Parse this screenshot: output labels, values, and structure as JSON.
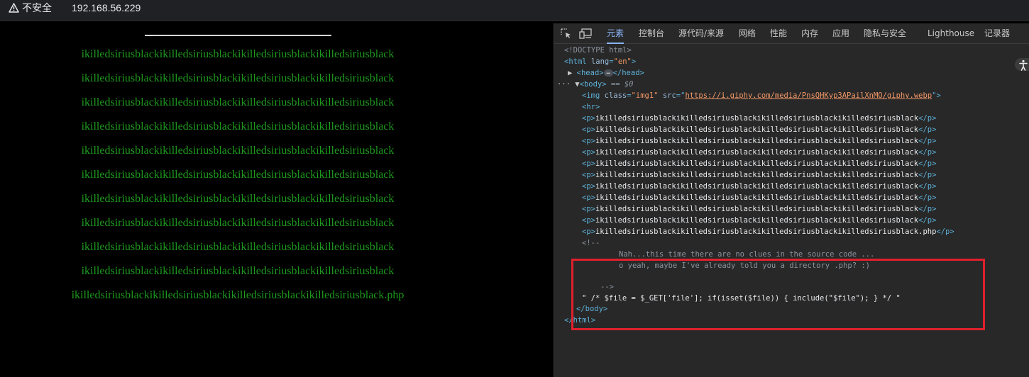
{
  "addressbar": {
    "security_text": "不安全",
    "url": "192.168.56.229"
  },
  "page": {
    "paragraphs": [
      "ikilledsiriusblackikilledsiriusblackikilledsiriusblackikilledsiriusblack",
      "ikilledsiriusblackikilledsiriusblackikilledsiriusblackikilledsiriusblack",
      "ikilledsiriusblackikilledsiriusblackikilledsiriusblackikilledsiriusblack",
      "ikilledsiriusblackikilledsiriusblackikilledsiriusblackikilledsiriusblack",
      "ikilledsiriusblackikilledsiriusblackikilledsiriusblackikilledsiriusblack",
      "ikilledsiriusblackikilledsiriusblackikilledsiriusblackikilledsiriusblack",
      "ikilledsiriusblackikilledsiriusblackikilledsiriusblackikilledsiriusblack",
      "ikilledsiriusblackikilledsiriusblackikilledsiriusblackikilledsiriusblack",
      "ikilledsiriusblackikilledsiriusblackikilledsiriusblackikilledsiriusblack",
      "ikilledsiriusblackikilledsiriusblackikilledsiriusblackikilledsiriusblack",
      "ikilledsiriusblackikilledsiriusblackikilledsiriusblackikilledsiriusblack.php"
    ],
    "text_color": "#1e9a1e"
  },
  "devtools": {
    "tabs": [
      "元素",
      "控制台",
      "源代码/来源",
      "网络",
      "性能",
      "内存",
      "应用",
      "隐私与安全",
      "Lighthouse",
      "记录器"
    ],
    "active_tab": "元素",
    "doctype": "<!DOCTYPE html>",
    "html_open": "<html",
    "lang_attr": "lang",
    "lang_val": "\"en\"",
    "head_open": "<head>",
    "head_close": "</head>",
    "body_open": "<body>",
    "body_eq": " == $0",
    "img_open": "<img",
    "img_class_attr": "class",
    "img_class_val": "\"img1\"",
    "img_src_attr": "src",
    "img_src_url": "https://i.giphy.com/media/PnsQHKyp3APailXnMO/giphy.webp",
    "img_close": "\">",
    "hr": "<hr>",
    "p_open": "<p>",
    "p_close": "</p>",
    "p_texts": [
      "ikilledsiriusblackikilledsiriusblackikilledsiriusblackikilledsiriusblack",
      "ikilledsiriusblackikilledsiriusblackikilledsiriusblackikilledsiriusblack",
      "ikilledsiriusblackikilledsiriusblackikilledsiriusblackikilledsiriusblack",
      "ikilledsiriusblackikilledsiriusblackikilledsiriusblackikilledsiriusblack",
      "ikilledsiriusblackikilledsiriusblackikilledsiriusblackikilledsiriusblack",
      "ikilledsiriusblackikilledsiriusblackikilledsiriusblackikilledsiriusblack",
      "ikilledsiriusblackikilledsiriusblackikilledsiriusblackikilledsiriusblack",
      "ikilledsiriusblackikilledsiriusblackikilledsiriusblackikilledsiriusblack",
      "ikilledsiriusblackikilledsiriusblackikilledsiriusblackikilledsiriusblack",
      "ikilledsiriusblackikilledsiriusblackikilledsiriusblackikilledsiriusblack",
      "ikilledsiriusblackikilledsiriusblackikilledsiriusblackikilledsiriusblack.php"
    ],
    "comment_open": "<!--",
    "comment_line1": "Nah...this time there are no clues in the source code ...",
    "comment_line2": "o yeah, maybe I've already told you a directory .php? :)",
    "comment_close": "-->",
    "text_node": "\" /* $file = $_GET['file']; if(isset($file)) { include(\"$file\"); } */ \"",
    "body_close": "</body>",
    "html_close": "</html>",
    "highlight_color": "#e0202c"
  }
}
